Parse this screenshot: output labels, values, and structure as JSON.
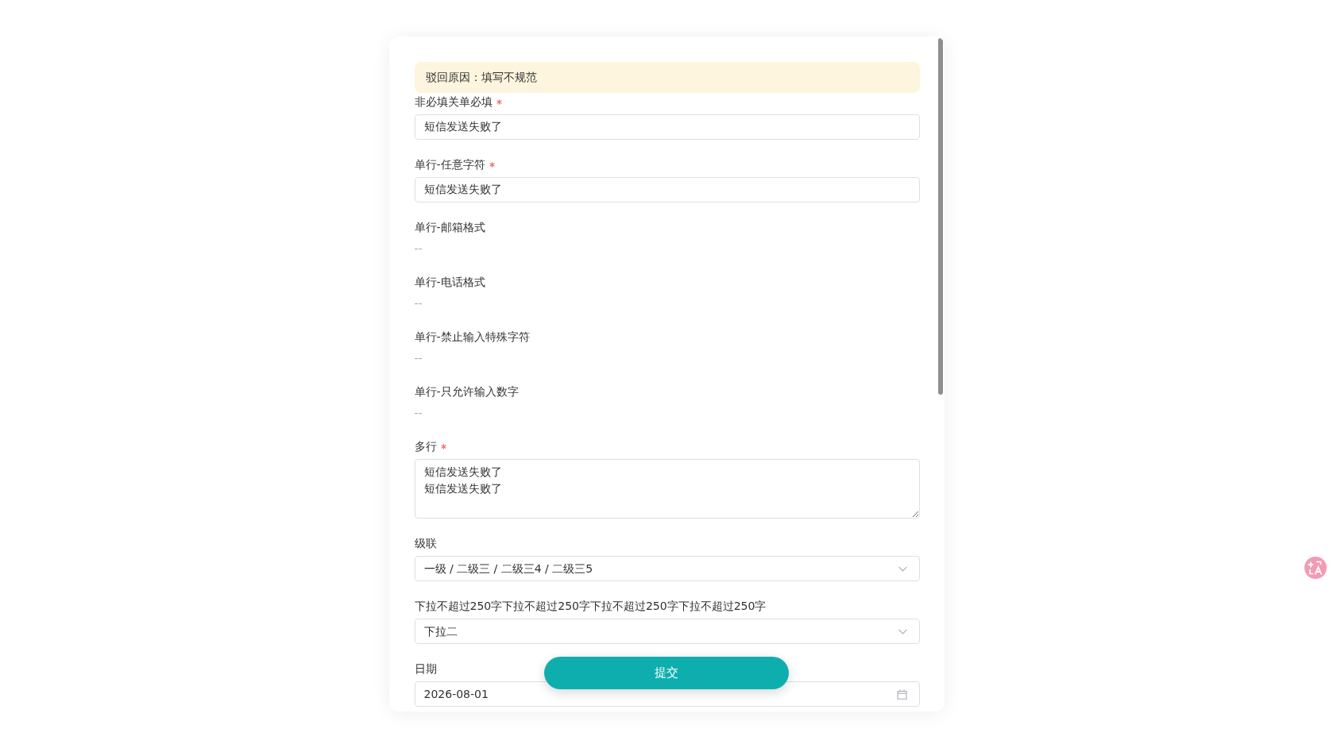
{
  "form": {
    "reject_notice": "驳回原因：填写不规范",
    "fields": [
      {
        "kind": "input",
        "label": "非必填关单必填",
        "required": true,
        "value": "短信发送失败了"
      },
      {
        "kind": "input",
        "label": "单行-任意字符",
        "required": true,
        "value": "短信发送失败了"
      },
      {
        "kind": "text",
        "label": "单行-邮箱格式",
        "required": false,
        "value": "--"
      },
      {
        "kind": "text",
        "label": "单行-电话格式",
        "required": false,
        "value": "--"
      },
      {
        "kind": "text",
        "label": "单行-禁止输入特殊字符",
        "required": false,
        "value": "--"
      },
      {
        "kind": "text",
        "label": "单行-只允许输入数字",
        "required": false,
        "value": "--"
      },
      {
        "kind": "textarea",
        "label": "多行",
        "required": true,
        "lines": [
          "短信发送失败了",
          "短信发送失败了"
        ]
      },
      {
        "kind": "select",
        "label": "级联",
        "required": false,
        "value": "一级 / 二级三 / 二级三4 / 二级三5"
      },
      {
        "kind": "select",
        "label": "下拉不超过250字下拉不超过250字下拉不超过250字下拉不超过250字",
        "required": false,
        "value": "下拉二"
      },
      {
        "kind": "date",
        "label": "日期",
        "required": false,
        "value": "2026-08-01"
      }
    ]
  },
  "submit_button": "提交"
}
